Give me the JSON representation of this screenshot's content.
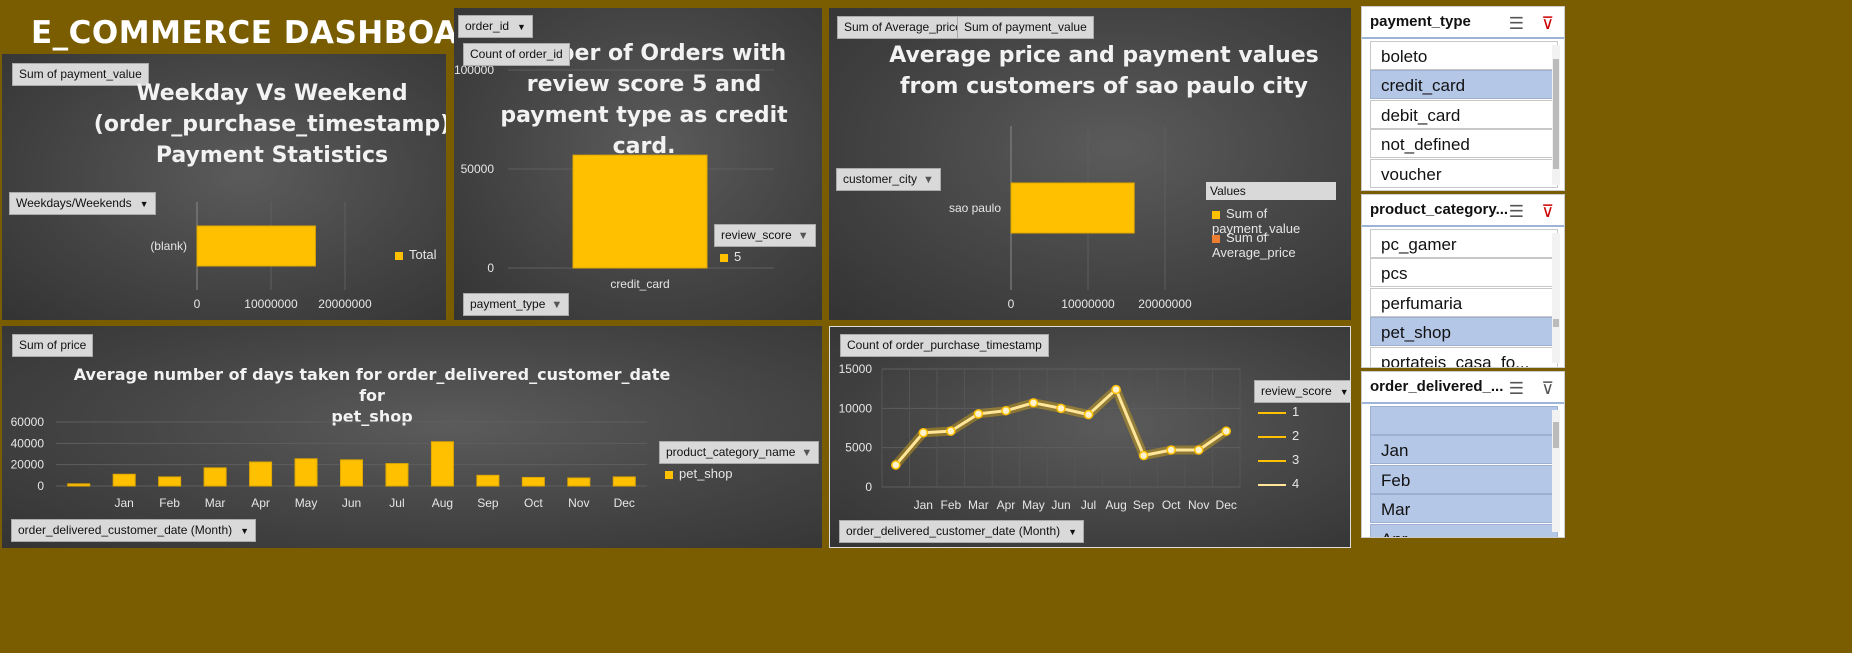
{
  "dashboard_title": "E_COMMERCE DASHBOARD",
  "colors": {
    "bar": "#ffc000",
    "bar_dark": "#e0a800",
    "line": "#ffe699",
    "background": "#7a5d00",
    "slicer_selected": "#b4c7e7"
  },
  "panels": {
    "weekday": {
      "value_button": "Sum of payment_value",
      "title_lines": [
        "Weekday Vs Weekend",
        "(order_purchase_timestamp)",
        "Payment Statistics"
      ],
      "axis_button": "Weekdays/Weekends",
      "legend": "Total"
    },
    "orders": {
      "filter_button": "order_id",
      "value_button": "Count of order_id",
      "title_lines": [
        "Number of Orders with",
        "review score 5 and",
        "payment type as credit",
        "card."
      ],
      "legend_button": "review_score",
      "legend": "5",
      "axis_button": "payment_type"
    },
    "sao_paulo": {
      "value_button_1": "Sum of Average_price",
      "value_button_2": "Sum of payment_value",
      "title_lines": [
        "Average price and payment values",
        "from customers of sao paulo city"
      ],
      "axis_button": "customer_city",
      "legend_title": "Values",
      "legend_1": "Sum of payment_value",
      "legend_2": "Sum of Average_price"
    },
    "pet_shop": {
      "value_button": "Sum of price",
      "title_lines": [
        "Average number of days taken for order_delivered_customer_date for",
        "pet_shop"
      ],
      "legend_button": "product_category_name",
      "legend": "pet_shop",
      "axis_button": "order_delivered_customer_date  (Month)"
    },
    "timestamp": {
      "value_button": "Count of order_purchase_timestamp",
      "legend_button": "review_score",
      "legend_items": [
        "1",
        "2",
        "3",
        "4"
      ],
      "axis_button": "order_delivered_customer_date  (Month)"
    }
  },
  "chart_data": [
    {
      "id": "weekday",
      "type": "bar",
      "orientation": "horizontal",
      "categories": [
        "(blank)"
      ],
      "series": [
        {
          "name": "Total",
          "values": [
            16000000
          ]
        }
      ],
      "xlim": [
        0,
        20000000
      ],
      "xticks": [
        "0",
        "10000000",
        "20000000"
      ]
    },
    {
      "id": "orders",
      "type": "bar",
      "categories": [
        "credit_card"
      ],
      "series": [
        {
          "name": "5",
          "values": [
            57000
          ]
        }
      ],
      "ylim": [
        0,
        100000
      ],
      "yticks": [
        "0",
        "50000",
        "100000"
      ]
    },
    {
      "id": "sao_paulo",
      "type": "bar",
      "orientation": "horizontal",
      "categories": [
        "sao paulo"
      ],
      "series": [
        {
          "name": "Sum of payment_value",
          "values": [
            16000000
          ]
        },
        {
          "name": "Sum of Average_price",
          "values": [
            0
          ]
        }
      ],
      "xlim": [
        0,
        20000000
      ],
      "xticks": [
        "0",
        "10000000",
        "20000000"
      ]
    },
    {
      "id": "pet_shop",
      "type": "bar",
      "categories": [
        "",
        "Jan",
        "Feb",
        "Mar",
        "Apr",
        "May",
        "Jun",
        "Jul",
        "Aug",
        "Sep",
        "Oct",
        "Nov",
        "Dec"
      ],
      "series": [
        {
          "name": "pet_shop",
          "values": [
            2000,
            11000,
            8500,
            17000,
            22500,
            25500,
            24500,
            21000,
            41500,
            10000,
            8000,
            7500,
            8500
          ]
        }
      ],
      "ylim": [
        0,
        60000
      ],
      "yticks": [
        "0",
        "20000",
        "40000",
        "60000"
      ]
    },
    {
      "id": "timestamp",
      "type": "line",
      "categories": [
        "",
        "Jan",
        "Feb",
        "Mar",
        "Apr",
        "May",
        "Jun",
        "Jul",
        "Aug",
        "Sep",
        "Oct",
        "Nov",
        "Dec"
      ],
      "series": [
        {
          "name": "4",
          "values": [
            2800,
            6900,
            7100,
            9300,
            9700,
            10700,
            10000,
            9200,
            12400,
            4000,
            4700,
            4700,
            7100
          ]
        }
      ],
      "ylim": [
        0,
        15000
      ],
      "yticks": [
        "0",
        "5000",
        "10000",
        "15000"
      ]
    }
  ],
  "slicers": [
    {
      "title": "payment_type",
      "items": [
        {
          "label": "boleto",
          "selected": false
        },
        {
          "label": "credit_card",
          "selected": true
        },
        {
          "label": "debit_card",
          "selected": false
        },
        {
          "label": "not_defined",
          "selected": false
        },
        {
          "label": "voucher",
          "selected": false
        }
      ]
    },
    {
      "title": "product_category...",
      "items": [
        {
          "label": "pc_gamer",
          "selected": false
        },
        {
          "label": "pcs",
          "selected": false
        },
        {
          "label": "perfumaria",
          "selected": false
        },
        {
          "label": "pet_shop",
          "selected": true
        },
        {
          "label": "portateis_casa_fo...",
          "selected": false
        }
      ]
    },
    {
      "title": "order_delivered_...",
      "items": [
        {
          "label": "",
          "selected": true
        },
        {
          "label": "Jan",
          "selected": true
        },
        {
          "label": "Feb",
          "selected": true
        },
        {
          "label": "Mar",
          "selected": true
        },
        {
          "label": "Apr",
          "selected": true
        }
      ]
    }
  ]
}
